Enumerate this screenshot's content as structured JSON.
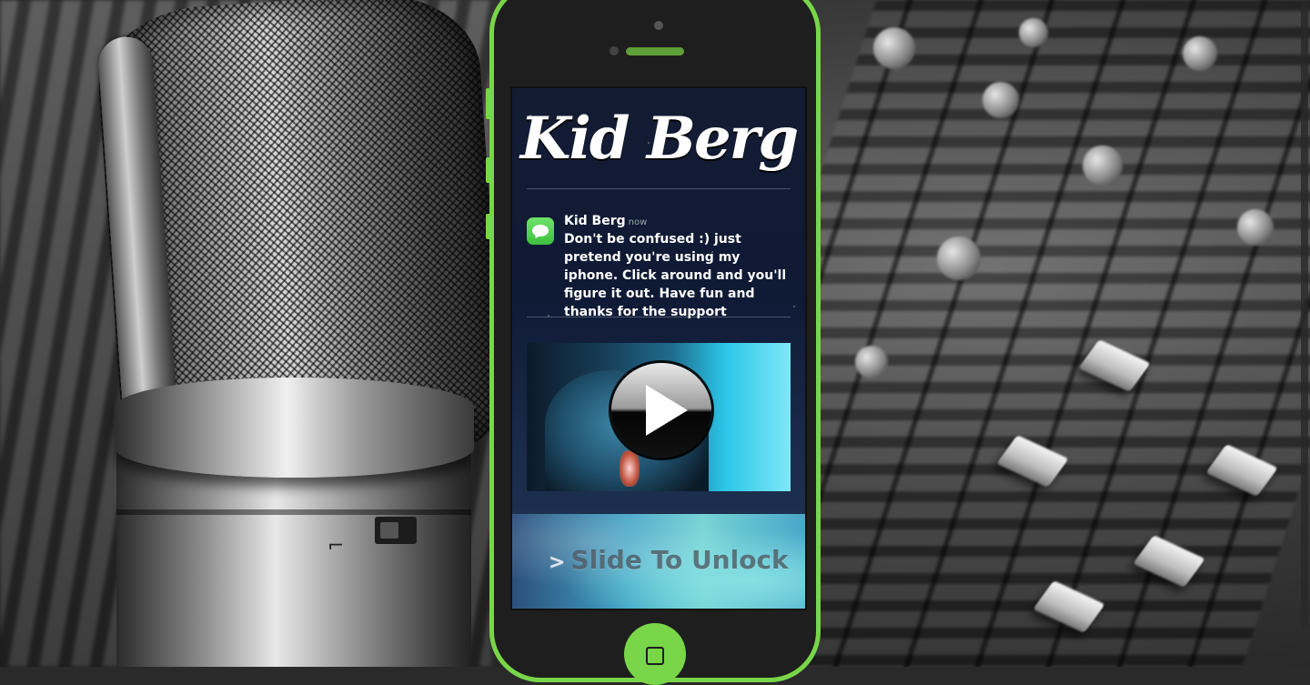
{
  "logo": {
    "text": "Kid Berg"
  },
  "notification": {
    "sender": "Kid Berg",
    "time": "now",
    "message": "Don't be confused :) just pretend you're using my iphone. Click around and you'll figure it out. Have fun and thanks for the support"
  },
  "lock_screen": {
    "slide_label": "Slide To Unlock",
    "slide_arrow": ">"
  },
  "icons": {
    "message": "messages-icon",
    "play": "play-icon",
    "home": "home-square-icon"
  },
  "colors": {
    "accent_green": "#78d648",
    "phone_body": "#1e1e1e",
    "message_green": "#4fd14c"
  }
}
